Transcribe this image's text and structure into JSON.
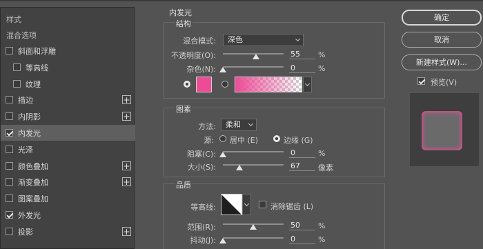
{
  "left_panel": {
    "header": "样式",
    "blending_options": "混合选项",
    "items": [
      {
        "label": "斜面和浮雕",
        "checked": false,
        "indent": 0,
        "plus": false,
        "selected": false
      },
      {
        "label": "等高线",
        "checked": false,
        "indent": 1,
        "plus": false,
        "selected": false
      },
      {
        "label": "纹理",
        "checked": false,
        "indent": 1,
        "plus": false,
        "selected": false
      },
      {
        "label": "描边",
        "checked": false,
        "indent": 0,
        "plus": true,
        "selected": false
      },
      {
        "label": "内阴影",
        "checked": false,
        "indent": 0,
        "plus": true,
        "selected": false
      },
      {
        "label": "内发光",
        "checked": true,
        "indent": 0,
        "plus": false,
        "selected": true
      },
      {
        "label": "光泽",
        "checked": false,
        "indent": 0,
        "plus": false,
        "selected": false
      },
      {
        "label": "颜色叠加",
        "checked": false,
        "indent": 0,
        "plus": true,
        "selected": false
      },
      {
        "label": "渐变叠加",
        "checked": false,
        "indent": 0,
        "plus": true,
        "selected": false
      },
      {
        "label": "图案叠加",
        "checked": false,
        "indent": 0,
        "plus": false,
        "selected": false
      },
      {
        "label": "外发光",
        "checked": true,
        "indent": 0,
        "plus": false,
        "selected": false
      },
      {
        "label": "投影",
        "checked": false,
        "indent": 0,
        "plus": true,
        "selected": false
      }
    ],
    "plus_glyph": "+"
  },
  "panel": {
    "title": "内发光",
    "structure": {
      "title": "结构",
      "blend_mode_label": "混合模式:",
      "blend_mode_value": "深色",
      "opacity_label": "不透明度(O):",
      "opacity_value": "55",
      "opacity_unit": "%",
      "opacity_level": 0.55,
      "noise_label": "杂色(N):",
      "noise_value": "0",
      "noise_unit": "%",
      "noise_level": 0,
      "glow_color": "#ec4b96",
      "color_radio_selected": true,
      "gradient_radio_selected": false
    },
    "elements": {
      "title": "图素",
      "technique_label": "方法:",
      "technique_value": "柔和",
      "source_label": "源:",
      "source_center": "居中 (E)",
      "source_edge": "边缘 (G)",
      "source_selected": "edge",
      "choke_label": "阻塞(C):",
      "choke_value": "0",
      "choke_unit": "%",
      "choke_level": 0,
      "size_label": "大小(S):",
      "size_value": "67",
      "size_unit": "像素",
      "size_level": 0.27
    },
    "quality": {
      "title": "品质",
      "contour_label": "等高线:",
      "antialias_label": "消除锯齿 (L)",
      "antialias_checked": false,
      "range_label": "范围(R):",
      "range_value": "50",
      "range_unit": "%",
      "range_level": 0.5,
      "jitter_label": "抖动(J):",
      "jitter_value": "0",
      "jitter_unit": "%",
      "jitter_level": 0
    }
  },
  "buttons": {
    "ok": "确定",
    "cancel": "取消",
    "new_style": "新建样式(W)...",
    "preview_label": "预览(V)",
    "preview_checked": true
  },
  "colors": {
    "accent_pink": "#ec4b96"
  }
}
